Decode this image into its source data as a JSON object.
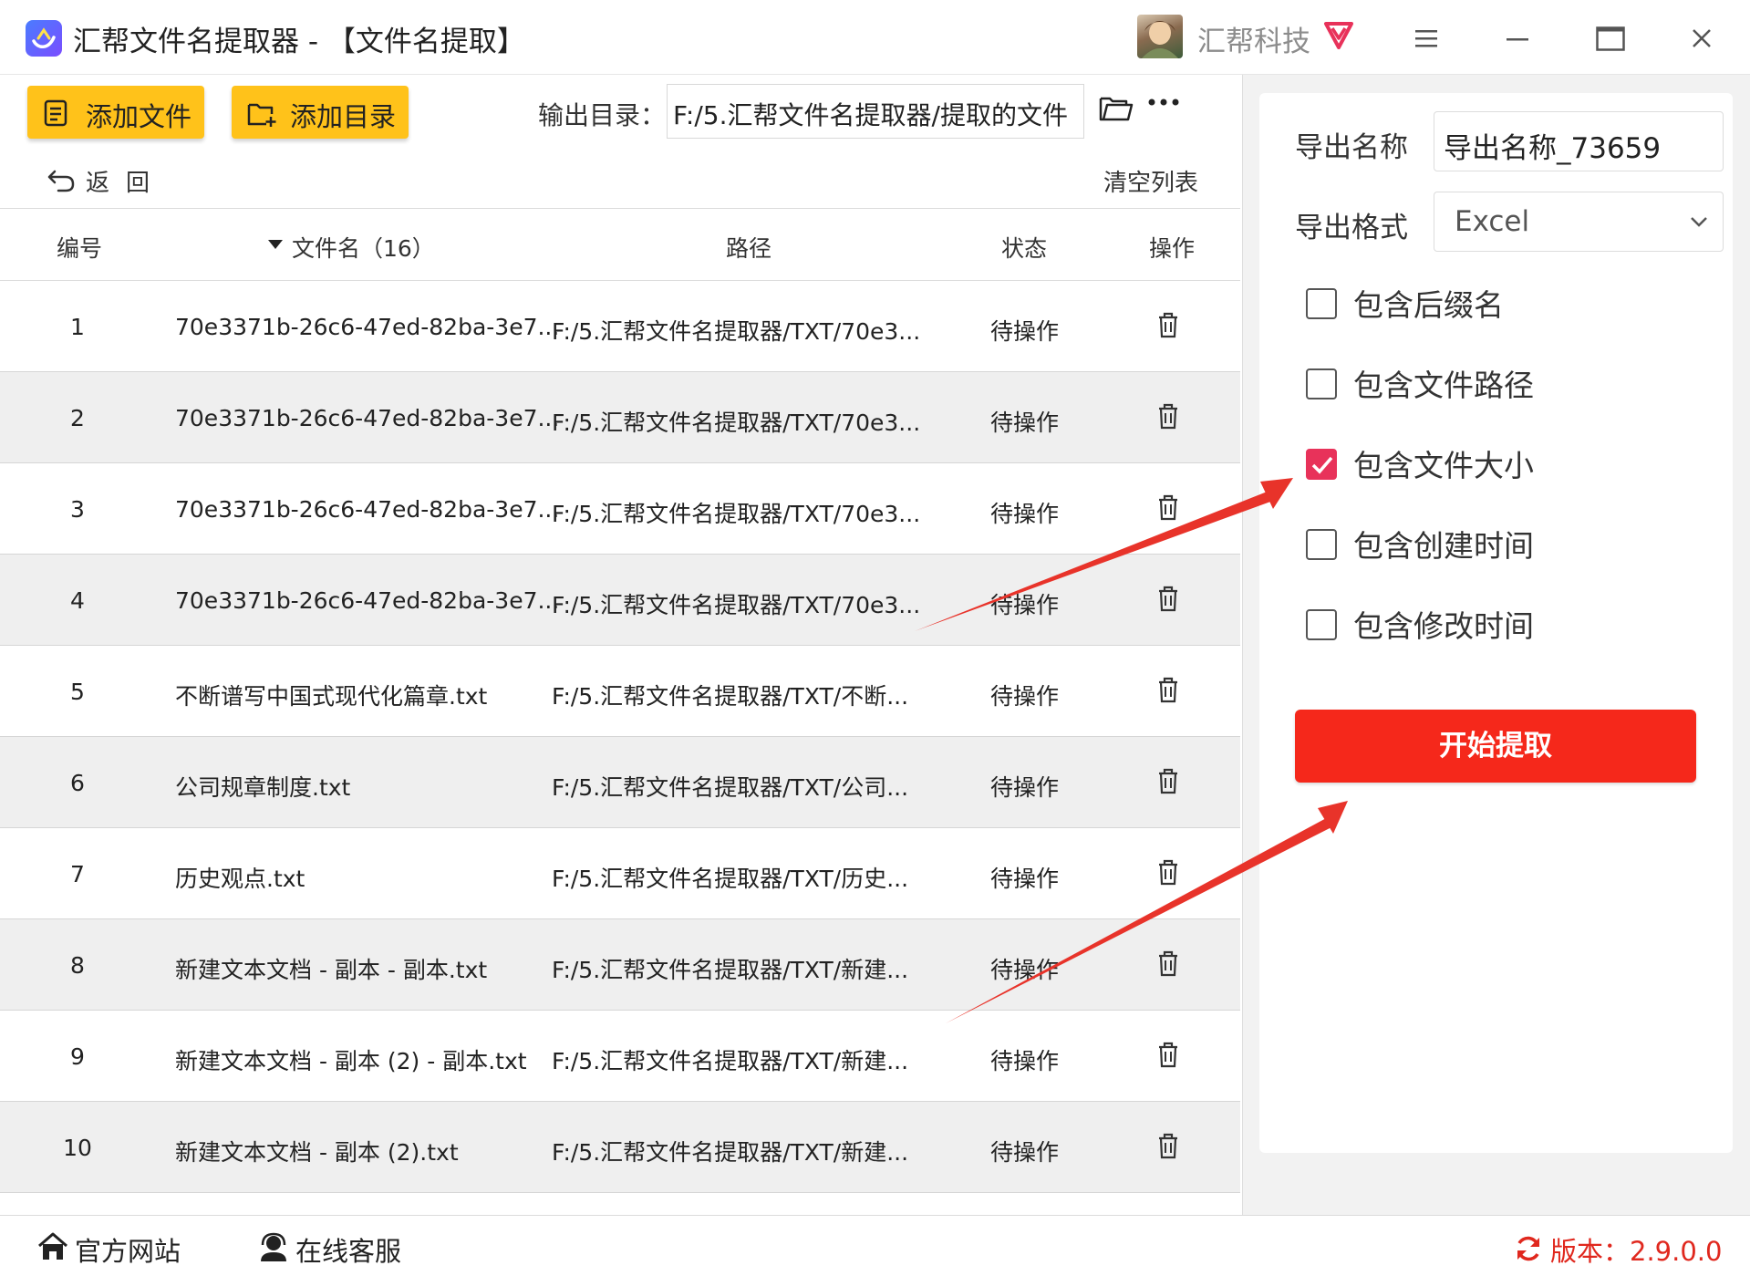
{
  "window": {
    "title": "汇帮文件名提取器 - 【文件名提取】",
    "brand": "汇帮科技",
    "icons": [
      "app-logo-icon",
      "avatar",
      "vip-diamond-icon",
      "menu-icon",
      "minimize-icon",
      "maximize-icon",
      "close-icon"
    ]
  },
  "toolbar": {
    "add_file_label": "添加文件",
    "add_dir_label": "添加目录",
    "output_label": "输出目录：",
    "output_path": "F:/5.汇帮文件名提取器/提取的文件",
    "back_label": "返回",
    "clear_label": "清空列表"
  },
  "table": {
    "headers": {
      "num": "编号",
      "name": "文件名（16）",
      "path": "路径",
      "status": "状态",
      "action": "操作"
    },
    "rows": [
      {
        "num": "1",
        "name": "70e3371b-26c6-47ed-82ba-3e7...",
        "path": "F:/5.汇帮文件名提取器/TXT/70e3...",
        "status": "待操作"
      },
      {
        "num": "2",
        "name": "70e3371b-26c6-47ed-82ba-3e7...",
        "path": "F:/5.汇帮文件名提取器/TXT/70e3...",
        "status": "待操作"
      },
      {
        "num": "3",
        "name": "70e3371b-26c6-47ed-82ba-3e7...",
        "path": "F:/5.汇帮文件名提取器/TXT/70e3...",
        "status": "待操作"
      },
      {
        "num": "4",
        "name": "70e3371b-26c6-47ed-82ba-3e7...",
        "path": "F:/5.汇帮文件名提取器/TXT/70e3...",
        "status": "待操作"
      },
      {
        "num": "5",
        "name": "不断谱写中国式现代化篇章.txt",
        "path": "F:/5.汇帮文件名提取器/TXT/不断...",
        "status": "待操作"
      },
      {
        "num": "6",
        "name": "公司规章制度.txt",
        "path": "F:/5.汇帮文件名提取器/TXT/公司...",
        "status": "待操作"
      },
      {
        "num": "7",
        "name": "历史观点.txt",
        "path": "F:/5.汇帮文件名提取器/TXT/历史...",
        "status": "待操作"
      },
      {
        "num": "8",
        "name": "新建文本文档 - 副本 - 副本.txt",
        "path": "F:/5.汇帮文件名提取器/TXT/新建...",
        "status": "待操作"
      },
      {
        "num": "9",
        "name": "新建文本文档 - 副本 (2) - 副本.txt",
        "path": "F:/5.汇帮文件名提取器/TXT/新建...",
        "status": "待操作"
      },
      {
        "num": "10",
        "name": "新建文本文档 - 副本 (2).txt",
        "path": "F:/5.汇帮文件名提取器/TXT/新建...",
        "status": "待操作"
      }
    ]
  },
  "panel": {
    "export_name_label": "导出名称",
    "export_name_value": "导出名称_73659",
    "export_format_label": "导出格式",
    "export_format_value": "Excel",
    "options": [
      {
        "label": "包含后缀名",
        "checked": false
      },
      {
        "label": "包含文件路径",
        "checked": false
      },
      {
        "label": "包含文件大小",
        "checked": true
      },
      {
        "label": "包含创建时间",
        "checked": false
      },
      {
        "label": "包含修改时间",
        "checked": false
      }
    ],
    "start_label": "开始提取"
  },
  "footer": {
    "website_label": "官方网站",
    "support_label": "在线客服",
    "version_label": "版本：2.9.0.0"
  },
  "colors": {
    "accent_yellow": "#ffc21a",
    "start_red": "#f5281b",
    "checkbox_pink": "#e8325a",
    "annotation_red": "#e8332a",
    "version_red": "#e0281e"
  }
}
